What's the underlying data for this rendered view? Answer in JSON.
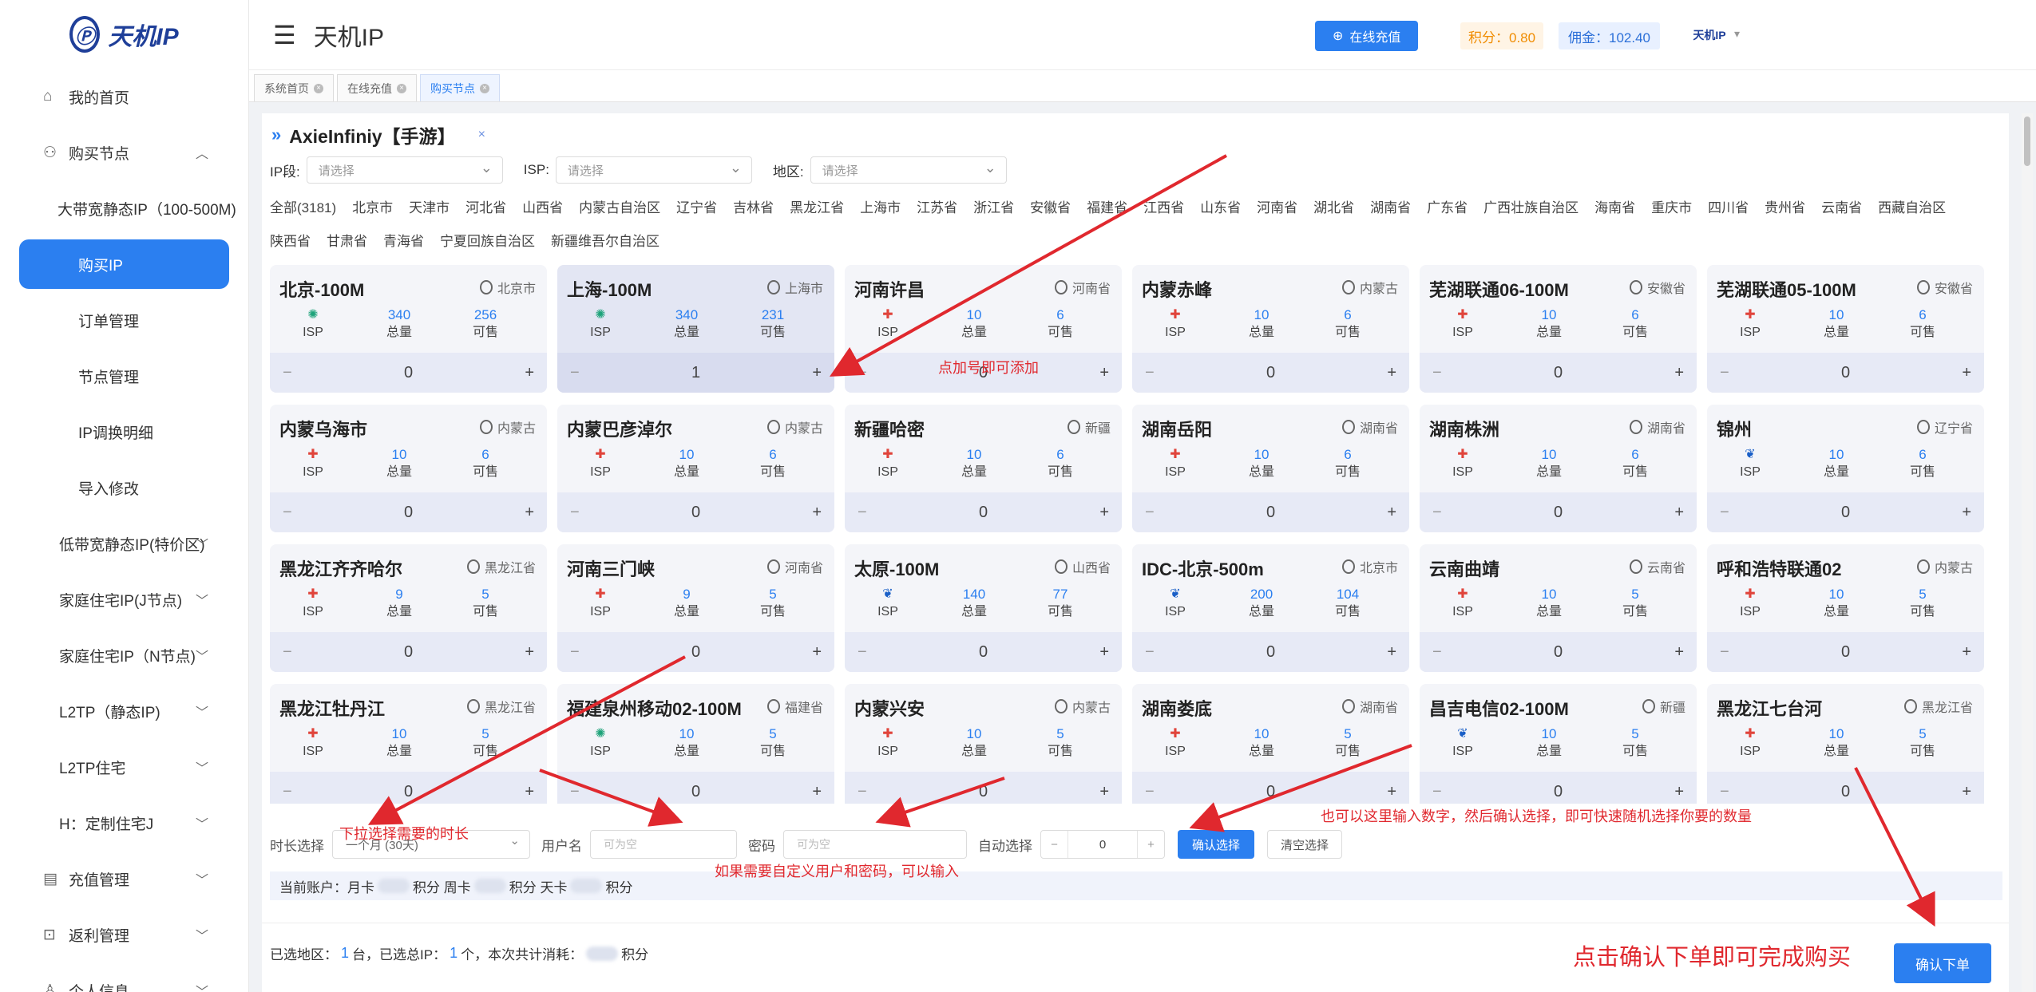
{
  "brand": {
    "logo_text": "天机IP",
    "logo_mark": "Ⓟ"
  },
  "sidebar": {
    "items": [
      {
        "label": "我的首页",
        "icon": "home-icon",
        "glyph": "⌂"
      },
      {
        "label": "购买节点",
        "icon": "people-icon",
        "glyph": "⚇",
        "arrow": "︿"
      },
      {
        "label": "大带宽静态IP（100-500M)",
        "arrow": "︿"
      },
      {
        "label": "购买IP"
      },
      {
        "label": "订单管理"
      },
      {
        "label": "节点管理"
      },
      {
        "label": "IP调换明细"
      },
      {
        "label": "导入修改"
      },
      {
        "label": "低带宽静态IP(特价区)",
        "arrow": "﹀"
      },
      {
        "label": "家庭住宅IP(J节点)",
        "arrow": "﹀"
      },
      {
        "label": "家庭住宅IP（N节点)",
        "arrow": "﹀"
      },
      {
        "label": "L2TP（静态IP)",
        "arrow": "﹀"
      },
      {
        "label": "L2TP住宅",
        "arrow": "﹀"
      },
      {
        "label": "H：定制住宅J",
        "arrow": "﹀"
      },
      {
        "label": "充值管理",
        "icon": "wallet-icon",
        "glyph": "▤",
        "arrow": "﹀"
      },
      {
        "label": "返利管理",
        "icon": "lock-icon",
        "glyph": "⊡",
        "arrow": "﹀"
      },
      {
        "label": "个人信息",
        "icon": "user-icon",
        "glyph": "♙",
        "arrow": "﹀"
      }
    ]
  },
  "header": {
    "menu_glyph": "☰",
    "title": "天机IP",
    "recharge_label": "在线充值",
    "recharge_glyph": "⊕",
    "points_label": "积分：0.80",
    "commission_label": "佣金：102.40",
    "avatar_text": "天机IP",
    "caret": "▾"
  },
  "tabs": [
    {
      "label": "系统首页",
      "close": "×"
    },
    {
      "label": "在线充值",
      "close": "×"
    },
    {
      "label": "购买节点",
      "close": "×"
    }
  ],
  "panel": {
    "title": "AxieInfiniy【手游】",
    "title_glyph": "»",
    "close_glyph": "×",
    "filters": [
      {
        "label": "IP段:",
        "placeholder": "请选择"
      },
      {
        "label": "ISP:",
        "placeholder": "请选择"
      },
      {
        "label": "地区:",
        "placeholder": "请选择"
      }
    ],
    "regions": [
      "全部(3181)",
      "北京市",
      "天津市",
      "河北省",
      "山西省",
      "内蒙古自治区",
      "辽宁省",
      "吉林省",
      "黑龙江省",
      "上海市",
      "江苏省",
      "浙江省",
      "安徽省",
      "福建省",
      "江西省",
      "山东省",
      "河南省",
      "湖北省",
      "湖南省",
      "广东省",
      "广西壮族自治区",
      "海南省",
      "重庆市",
      "四川省",
      "贵州省",
      "云南省",
      "西藏自治区",
      "陕西省",
      "甘肃省",
      "青海省",
      "宁夏回族自治区",
      "新疆维吾尔自治区"
    ]
  },
  "labels": {
    "isp": "ISP",
    "total": "总量",
    "available": "可售",
    "minus": "−",
    "plus": "+"
  },
  "nodes": [
    {
      "name": "北京-100M",
      "loc": "北京市",
      "isp": "green",
      "isp_glyph": "✺",
      "total": "340",
      "avail": "256",
      "qty": "0"
    },
    {
      "name": "上海-100M",
      "loc": "上海市",
      "isp": "green",
      "isp_glyph": "✺",
      "total": "340",
      "avail": "231",
      "qty": "1",
      "highlight": true
    },
    {
      "name": "河南许昌",
      "loc": "河南省",
      "isp": "red",
      "isp_glyph": "✚",
      "total": "10",
      "avail": "6",
      "qty": "0"
    },
    {
      "name": "内蒙赤峰",
      "loc": "内蒙古",
      "isp": "red",
      "isp_glyph": "✚",
      "total": "10",
      "avail": "6",
      "qty": "0"
    },
    {
      "name": "芜湖联通06-100M",
      "loc": "安徽省",
      "isp": "red",
      "isp_glyph": "✚",
      "total": "10",
      "avail": "6",
      "qty": "0"
    },
    {
      "name": "芜湖联通05-100M",
      "loc": "安徽省",
      "isp": "red",
      "isp_glyph": "✚",
      "total": "10",
      "avail": "6",
      "qty": "0"
    },
    {
      "name": "内蒙乌海市",
      "loc": "内蒙古",
      "isp": "red",
      "isp_glyph": "✚",
      "total": "10",
      "avail": "6",
      "qty": "0"
    },
    {
      "name": "内蒙巴彦淖尔",
      "loc": "内蒙古",
      "isp": "red",
      "isp_glyph": "✚",
      "total": "10",
      "avail": "6",
      "qty": "0"
    },
    {
      "name": "新疆哈密",
      "loc": "新疆",
      "isp": "red",
      "isp_glyph": "✚",
      "total": "10",
      "avail": "6",
      "qty": "0"
    },
    {
      "name": "湖南岳阳",
      "loc": "湖南省",
      "isp": "red",
      "isp_glyph": "✚",
      "total": "10",
      "avail": "6",
      "qty": "0"
    },
    {
      "name": "湖南株洲",
      "loc": "湖南省",
      "isp": "red",
      "isp_glyph": "✚",
      "total": "10",
      "avail": "6",
      "qty": "0"
    },
    {
      "name": "锦州",
      "loc": "辽宁省",
      "isp": "blue",
      "isp_glyph": "❦",
      "total": "10",
      "avail": "6",
      "qty": "0"
    },
    {
      "name": "黑龙江齐齐哈尔",
      "loc": "黑龙江省",
      "isp": "red",
      "isp_glyph": "✚",
      "total": "9",
      "avail": "5",
      "qty": "0"
    },
    {
      "name": "河南三门峡",
      "loc": "河南省",
      "isp": "red",
      "isp_glyph": "✚",
      "total": "9",
      "avail": "5",
      "qty": "0"
    },
    {
      "name": "太原-100M",
      "loc": "山西省",
      "isp": "blue",
      "isp_glyph": "❦",
      "total": "140",
      "avail": "77",
      "qty": "0"
    },
    {
      "name": "IDC-北京-500m",
      "loc": "北京市",
      "isp": "blue",
      "isp_glyph": "❦",
      "total": "200",
      "avail": "104",
      "qty": "0"
    },
    {
      "name": "云南曲靖",
      "loc": "云南省",
      "isp": "red",
      "isp_glyph": "✚",
      "total": "10",
      "avail": "5",
      "qty": "0"
    },
    {
      "name": "呼和浩特联通02",
      "loc": "内蒙古",
      "isp": "red",
      "isp_glyph": "✚",
      "total": "10",
      "avail": "5",
      "qty": "0"
    },
    {
      "name": "黑龙江牡丹江",
      "loc": "黑龙江省",
      "isp": "red",
      "isp_glyph": "✚",
      "total": "10",
      "avail": "5",
      "qty": "0"
    },
    {
      "name": "福建泉州移动02-100M",
      "loc": "福建省",
      "isp": "green",
      "isp_glyph": "✺",
      "total": "10",
      "avail": "5",
      "qty": "0"
    },
    {
      "name": "内蒙兴安",
      "loc": "内蒙古",
      "isp": "red",
      "isp_glyph": "✚",
      "total": "10",
      "avail": "5",
      "qty": "0"
    },
    {
      "name": "湖南娄底",
      "loc": "湖南省",
      "isp": "red",
      "isp_glyph": "✚",
      "total": "10",
      "avail": "5",
      "qty": "0"
    },
    {
      "name": "昌吉电信02-100M",
      "loc": "新疆",
      "isp": "blue",
      "isp_glyph": "❦",
      "total": "10",
      "avail": "5",
      "qty": "0"
    },
    {
      "name": "黑龙江七台河",
      "loc": "黑龙江省",
      "isp": "red",
      "isp_glyph": "✚",
      "total": "10",
      "avail": "5",
      "qty": "0"
    }
  ],
  "form": {
    "duration_label": "时长选择",
    "duration_value": "一个月 (30天)",
    "username_label": "用户名",
    "username_placeholder": "可为空",
    "password_label": "密码",
    "password_placeholder": "可为空",
    "auto_label": "自动选择",
    "auto_minus": "−",
    "auto_value": "0",
    "auto_plus": "+",
    "confirm_label": "确认选择",
    "clear_label": "清空选择"
  },
  "account": {
    "prefix": "当前账户：月卡",
    "p1": "积分 周卡",
    "p2": "积分 天卡",
    "p3": "积分"
  },
  "summary": {
    "a": "已选地区：",
    "regions_count": "1",
    "b": "台，已选总IP：",
    "ip_count": "1",
    "c": "个，本次共计消耗：",
    "d": "积分"
  },
  "order_label": "确认下单",
  "annotations": {
    "add_hint": "点加号即可添加",
    "duration_hint": "下拉选择需要的时长",
    "custom_hint": "如果需要自定义用户和密码，可以输入",
    "auto_hint": "也可以这里输入数字，然后确认选择，即可快速随机选择你要的数量",
    "order_hint": "点击确认下单即可完成购买"
  },
  "colors": {
    "accent": "#2b7ff0",
    "annotation": "#e0282e",
    "points": "#f08c00"
  }
}
